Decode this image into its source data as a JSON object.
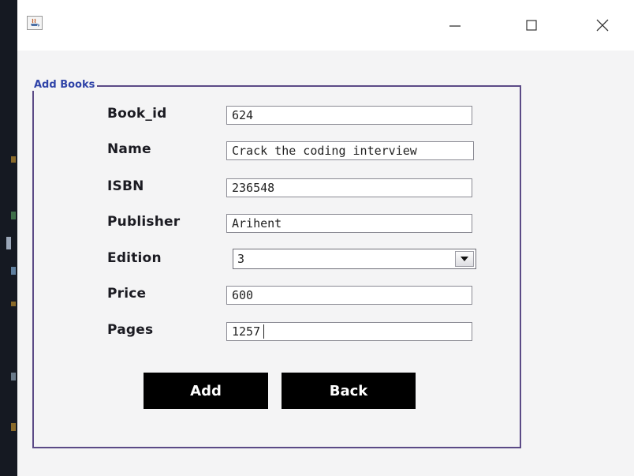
{
  "window": {
    "title": "",
    "app_icon": "java-app-icon",
    "minimize_icon": "minimize-icon",
    "maximize_icon": "maximize-icon",
    "close_icon": "close-icon"
  },
  "form": {
    "group_title": "Add Books",
    "fields": [
      {
        "label": "Book_id",
        "value": "624"
      },
      {
        "label": "Name",
        "value": "Crack the coding interview"
      },
      {
        "label": "ISBN",
        "value": "236548"
      },
      {
        "label": "Publisher",
        "value": "Arihent"
      },
      {
        "label": "Edition",
        "value": "3"
      },
      {
        "label": "Price",
        "value": "600"
      },
      {
        "label": "Pages",
        "value": "1257"
      }
    ],
    "edition_dropdown_icon": "chevron-down-icon"
  },
  "buttons": {
    "add_label": "Add",
    "back_label": "Back"
  },
  "colors": {
    "group_border": "#5b4a86",
    "group_title": "#2f43a8",
    "button_bg": "#000000",
    "button_text": "#ffffff"
  }
}
